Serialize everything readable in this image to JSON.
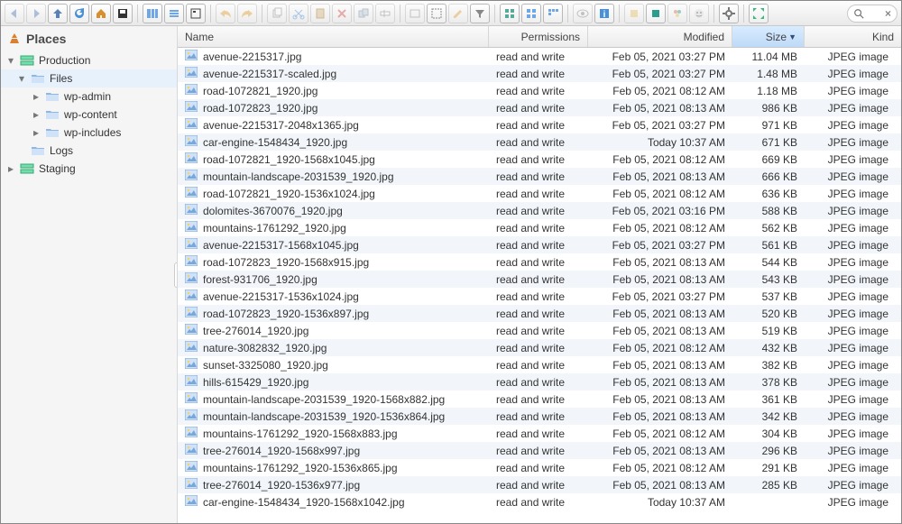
{
  "sidebar": {
    "title": "Places",
    "tree": [
      {
        "label": "Production",
        "depth": 0,
        "exp": true,
        "icon": "server"
      },
      {
        "label": "Files",
        "depth": 1,
        "exp": true,
        "icon": "folder",
        "sel": true
      },
      {
        "label": "wp-admin",
        "depth": 2,
        "exp": false,
        "icon": "folder"
      },
      {
        "label": "wp-content",
        "depth": 2,
        "exp": false,
        "icon": "folder"
      },
      {
        "label": "wp-includes",
        "depth": 2,
        "exp": false,
        "icon": "folder"
      },
      {
        "label": "Logs",
        "depth": 1,
        "exp": null,
        "icon": "folder"
      },
      {
        "label": "Staging",
        "depth": 0,
        "exp": false,
        "icon": "server"
      }
    ]
  },
  "columns": {
    "name": "Name",
    "perm": "Permissions",
    "mod": "Modified",
    "size": "Size",
    "kind": "Kind"
  },
  "rows": [
    {
      "name": "avenue-2215317.jpg",
      "perm": "read and write",
      "mod": "Feb 05, 2021 03:27 PM",
      "size": "11.04 MB",
      "kind": "JPEG image"
    },
    {
      "name": "avenue-2215317-scaled.jpg",
      "perm": "read and write",
      "mod": "Feb 05, 2021 03:27 PM",
      "size": "1.48 MB",
      "kind": "JPEG image"
    },
    {
      "name": "road-1072821_1920.jpg",
      "perm": "read and write",
      "mod": "Feb 05, 2021 08:12 AM",
      "size": "1.18 MB",
      "kind": "JPEG image"
    },
    {
      "name": "road-1072823_1920.jpg",
      "perm": "read and write",
      "mod": "Feb 05, 2021 08:13 AM",
      "size": "986 KB",
      "kind": "JPEG image"
    },
    {
      "name": "avenue-2215317-2048x1365.jpg",
      "perm": "read and write",
      "mod": "Feb 05, 2021 03:27 PM",
      "size": "971 KB",
      "kind": "JPEG image"
    },
    {
      "name": "car-engine-1548434_1920.jpg",
      "perm": "read and write",
      "mod": "Today 10:37 AM",
      "size": "671 KB",
      "kind": "JPEG image"
    },
    {
      "name": "road-1072821_1920-1568x1045.jpg",
      "perm": "read and write",
      "mod": "Feb 05, 2021 08:12 AM",
      "size": "669 KB",
      "kind": "JPEG image"
    },
    {
      "name": "mountain-landscape-2031539_1920.jpg",
      "perm": "read and write",
      "mod": "Feb 05, 2021 08:13 AM",
      "size": "666 KB",
      "kind": "JPEG image"
    },
    {
      "name": "road-1072821_1920-1536x1024.jpg",
      "perm": "read and write",
      "mod": "Feb 05, 2021 08:12 AM",
      "size": "636 KB",
      "kind": "JPEG image"
    },
    {
      "name": "dolomites-3670076_1920.jpg",
      "perm": "read and write",
      "mod": "Feb 05, 2021 03:16 PM",
      "size": "588 KB",
      "kind": "JPEG image"
    },
    {
      "name": "mountains-1761292_1920.jpg",
      "perm": "read and write",
      "mod": "Feb 05, 2021 08:12 AM",
      "size": "562 KB",
      "kind": "JPEG image"
    },
    {
      "name": "avenue-2215317-1568x1045.jpg",
      "perm": "read and write",
      "mod": "Feb 05, 2021 03:27 PM",
      "size": "561 KB",
      "kind": "JPEG image"
    },
    {
      "name": "road-1072823_1920-1568x915.jpg",
      "perm": "read and write",
      "mod": "Feb 05, 2021 08:13 AM",
      "size": "544 KB",
      "kind": "JPEG image"
    },
    {
      "name": "forest-931706_1920.jpg",
      "perm": "read and write",
      "mod": "Feb 05, 2021 08:13 AM",
      "size": "543 KB",
      "kind": "JPEG image"
    },
    {
      "name": "avenue-2215317-1536x1024.jpg",
      "perm": "read and write",
      "mod": "Feb 05, 2021 03:27 PM",
      "size": "537 KB",
      "kind": "JPEG image"
    },
    {
      "name": "road-1072823_1920-1536x897.jpg",
      "perm": "read and write",
      "mod": "Feb 05, 2021 08:13 AM",
      "size": "520 KB",
      "kind": "JPEG image"
    },
    {
      "name": "tree-276014_1920.jpg",
      "perm": "read and write",
      "mod": "Feb 05, 2021 08:13 AM",
      "size": "519 KB",
      "kind": "JPEG image"
    },
    {
      "name": "nature-3082832_1920.jpg",
      "perm": "read and write",
      "mod": "Feb 05, 2021 08:12 AM",
      "size": "432 KB",
      "kind": "JPEG image"
    },
    {
      "name": "sunset-3325080_1920.jpg",
      "perm": "read and write",
      "mod": "Feb 05, 2021 08:13 AM",
      "size": "382 KB",
      "kind": "JPEG image"
    },
    {
      "name": "hills-615429_1920.jpg",
      "perm": "read and write",
      "mod": "Feb 05, 2021 08:13 AM",
      "size": "378 KB",
      "kind": "JPEG image"
    },
    {
      "name": "mountain-landscape-2031539_1920-1568x882.jpg",
      "perm": "read and write",
      "mod": "Feb 05, 2021 08:13 AM",
      "size": "361 KB",
      "kind": "JPEG image"
    },
    {
      "name": "mountain-landscape-2031539_1920-1536x864.jpg",
      "perm": "read and write",
      "mod": "Feb 05, 2021 08:13 AM",
      "size": "342 KB",
      "kind": "JPEG image"
    },
    {
      "name": "mountains-1761292_1920-1568x883.jpg",
      "perm": "read and write",
      "mod": "Feb 05, 2021 08:12 AM",
      "size": "304 KB",
      "kind": "JPEG image"
    },
    {
      "name": "tree-276014_1920-1568x997.jpg",
      "perm": "read and write",
      "mod": "Feb 05, 2021 08:13 AM",
      "size": "296 KB",
      "kind": "JPEG image"
    },
    {
      "name": "mountains-1761292_1920-1536x865.jpg",
      "perm": "read and write",
      "mod": "Feb 05, 2021 08:12 AM",
      "size": "291 KB",
      "kind": "JPEG image"
    },
    {
      "name": "tree-276014_1920-1536x977.jpg",
      "perm": "read and write",
      "mod": "Feb 05, 2021 08:13 AM",
      "size": "285 KB",
      "kind": "JPEG image"
    },
    {
      "name": "car-engine-1548434_1920-1568x1042.jpg",
      "perm": "read and write",
      "mod": "Today 10:37 AM",
      "size": "",
      "kind": "JPEG image"
    }
  ],
  "toolbar": {
    "back": "back",
    "fwd": "forward",
    "up": "up",
    "refresh": "refresh",
    "home": "home",
    "save": "save",
    "cols": "columns",
    "list": "list",
    "report": "report",
    "undo": "undo",
    "redo": "redo",
    "copy": "copy",
    "cut": "cut",
    "paste": "paste",
    "delete": "delete",
    "dup": "duplicate",
    "rename": "rename",
    "view": "quick-look",
    "sel": "select",
    "edit": "edit",
    "filter": "filter",
    "g1": "grid1",
    "g2": "grid2",
    "g3": "grid3",
    "eye": "preview",
    "info": "info",
    "t1": "tag1",
    "t2": "tag2",
    "t3": "tag3",
    "t4": "tag4",
    "gear": "settings",
    "full": "fullscreen"
  }
}
